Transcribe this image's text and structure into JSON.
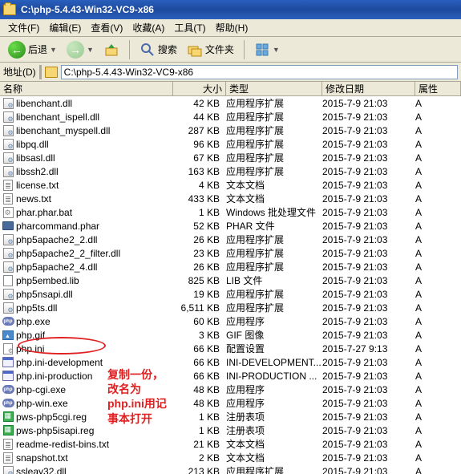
{
  "window": {
    "title": "C:\\php-5.4.43-Win32-VC9-x86"
  },
  "menu": {
    "file": "文件(F)",
    "edit": "编辑(E)",
    "view": "查看(V)",
    "favorites": "收藏(A)",
    "tools": "工具(T)",
    "help": "帮助(H)"
  },
  "toolbar": {
    "back": "后退",
    "search": "搜索",
    "folders": "文件夹"
  },
  "address": {
    "label": "地址(D)",
    "path": "C:\\php-5.4.43-Win32-VC9-x86"
  },
  "columns": {
    "name": "名称",
    "size": "大小",
    "type": "类型",
    "date": "修改日期",
    "attr": "属性"
  },
  "annotation": {
    "text": "复制一份，\n改名为\nphp.ini用记\n事本打开"
  },
  "files": [
    {
      "ico": "dll",
      "name": "libenchant.dll",
      "size": "42 KB",
      "type": "应用程序扩展",
      "date": "2015-7-9 21:03",
      "attr": "A"
    },
    {
      "ico": "dll",
      "name": "libenchant_ispell.dll",
      "size": "44 KB",
      "type": "应用程序扩展",
      "date": "2015-7-9 21:03",
      "attr": "A"
    },
    {
      "ico": "dll",
      "name": "libenchant_myspell.dll",
      "size": "287 KB",
      "type": "应用程序扩展",
      "date": "2015-7-9 21:03",
      "attr": "A"
    },
    {
      "ico": "dll",
      "name": "libpq.dll",
      "size": "96 KB",
      "type": "应用程序扩展",
      "date": "2015-7-9 21:03",
      "attr": "A"
    },
    {
      "ico": "dll",
      "name": "libsasl.dll",
      "size": "67 KB",
      "type": "应用程序扩展",
      "date": "2015-7-9 21:03",
      "attr": "A"
    },
    {
      "ico": "dll",
      "name": "libssh2.dll",
      "size": "163 KB",
      "type": "应用程序扩展",
      "date": "2015-7-9 21:03",
      "attr": "A"
    },
    {
      "ico": "txt",
      "name": "license.txt",
      "size": "4 KB",
      "type": "文本文档",
      "date": "2015-7-9 21:03",
      "attr": "A"
    },
    {
      "ico": "txt",
      "name": "news.txt",
      "size": "433 KB",
      "type": "文本文档",
      "date": "2015-7-9 21:03",
      "attr": "A"
    },
    {
      "ico": "bat",
      "name": "phar.phar.bat",
      "size": "1 KB",
      "type": "Windows 批处理文件",
      "date": "2015-7-9 21:03",
      "attr": "A"
    },
    {
      "ico": "phar",
      "name": "pharcommand.phar",
      "size": "52 KB",
      "type": "PHAR 文件",
      "date": "2015-7-9 21:03",
      "attr": "A"
    },
    {
      "ico": "dll",
      "name": "php5apache2_2.dll",
      "size": "26 KB",
      "type": "应用程序扩展",
      "date": "2015-7-9 21:03",
      "attr": "A"
    },
    {
      "ico": "dll",
      "name": "php5apache2_2_filter.dll",
      "size": "23 KB",
      "type": "应用程序扩展",
      "date": "2015-7-9 21:03",
      "attr": "A"
    },
    {
      "ico": "dll",
      "name": "php5apache2_4.dll",
      "size": "26 KB",
      "type": "应用程序扩展",
      "date": "2015-7-9 21:03",
      "attr": "A"
    },
    {
      "ico": "lib",
      "name": "php5embed.lib",
      "size": "825 KB",
      "type": "LIB 文件",
      "date": "2015-7-9 21:03",
      "attr": "A"
    },
    {
      "ico": "dll",
      "name": "php5nsapi.dll",
      "size": "19 KB",
      "type": "应用程序扩展",
      "date": "2015-7-9 21:03",
      "attr": "A"
    },
    {
      "ico": "dll",
      "name": "php5ts.dll",
      "size": "6,511 KB",
      "type": "应用程序扩展",
      "date": "2015-7-9 21:03",
      "attr": "A"
    },
    {
      "ico": "php",
      "name": "php.exe",
      "size": "60 KB",
      "type": "应用程序",
      "date": "2015-7-9 21:03",
      "attr": "A"
    },
    {
      "ico": "gif",
      "name": "php.gif",
      "size": "3 KB",
      "type": "GIF 图像",
      "date": "2015-7-9 21:03",
      "attr": "A"
    },
    {
      "ico": "ini",
      "name": "php.ini",
      "size": "66 KB",
      "type": "配置设置",
      "date": "2015-7-27 9:13",
      "attr": "A"
    },
    {
      "ico": "exe",
      "name": "php.ini-development",
      "size": "66 KB",
      "type": "INI-DEVELOPMENT...",
      "date": "2015-7-9 21:03",
      "attr": "A"
    },
    {
      "ico": "exe",
      "name": "php.ini-production",
      "size": "66 KB",
      "type": "INI-PRODUCTION ...",
      "date": "2015-7-9 21:03",
      "attr": "A"
    },
    {
      "ico": "php",
      "name": "php-cgi.exe",
      "size": "48 KB",
      "type": "应用程序",
      "date": "2015-7-9 21:03",
      "attr": "A"
    },
    {
      "ico": "php",
      "name": "php-win.exe",
      "size": "48 KB",
      "type": "应用程序",
      "date": "2015-7-9 21:03",
      "attr": "A"
    },
    {
      "ico": "reg",
      "name": "pws-php5cgi.reg",
      "size": "1 KB",
      "type": "注册表项",
      "date": "2015-7-9 21:03",
      "attr": "A"
    },
    {
      "ico": "reg",
      "name": "pws-php5isapi.reg",
      "size": "1 KB",
      "type": "注册表项",
      "date": "2015-7-9 21:03",
      "attr": "A"
    },
    {
      "ico": "txt",
      "name": "readme-redist-bins.txt",
      "size": "21 KB",
      "type": "文本文档",
      "date": "2015-7-9 21:03",
      "attr": "A"
    },
    {
      "ico": "txt",
      "name": "snapshot.txt",
      "size": "2 KB",
      "type": "文本文档",
      "date": "2015-7-9 21:03",
      "attr": "A"
    },
    {
      "ico": "dll",
      "name": "ssleay32.dll",
      "size": "213 KB",
      "type": "应用程序扩展",
      "date": "2015-7-9 21:03",
      "attr": "A"
    }
  ]
}
